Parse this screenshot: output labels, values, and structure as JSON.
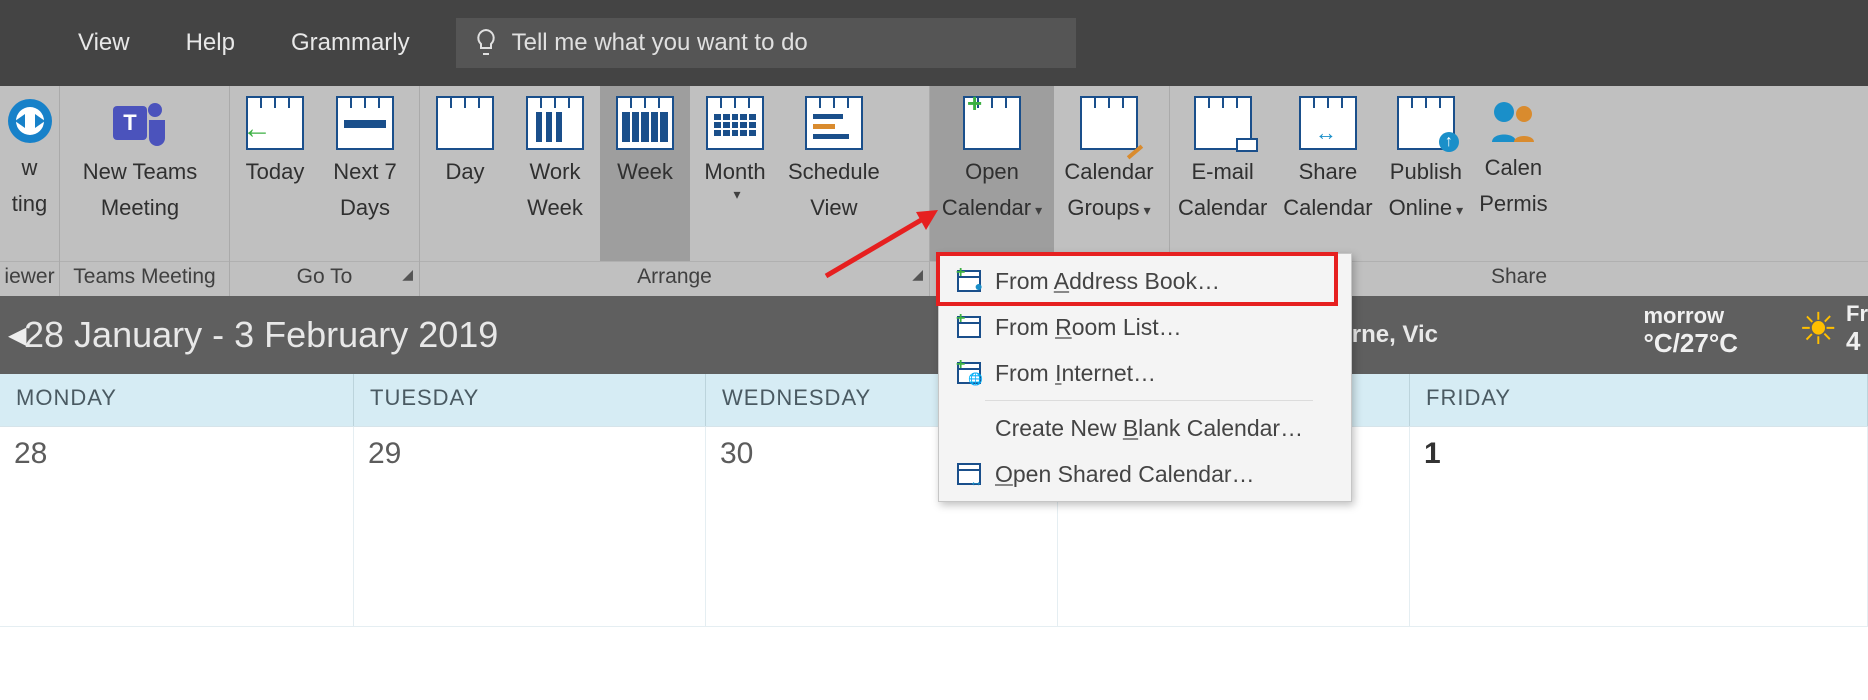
{
  "menu": {
    "view": "View",
    "help": "Help",
    "grammarly": "Grammarly",
    "tellme_placeholder": "Tell me what you want to do"
  },
  "ribbon": {
    "teamviewer": {
      "line1": "w",
      "line2": "ting",
      "group_label": "iewer"
    },
    "teams_meeting": {
      "label1": "New Teams",
      "label2": "Meeting",
      "group_label": "Teams Meeting"
    },
    "goto": {
      "today": "Today",
      "next7_1": "Next 7",
      "next7_2": "Days",
      "group_label": "Go To"
    },
    "arrange": {
      "day": "Day",
      "workweek_1": "Work",
      "workweek_2": "Week",
      "week": "Week",
      "month": "Month",
      "schedule_1": "Schedule",
      "schedule_2": "View",
      "group_label": "Arrange"
    },
    "manage": {
      "open_1": "Open",
      "open_2": "Calendar",
      "groups_1": "Calendar",
      "groups_2": "Groups"
    },
    "share": {
      "email_1": "E-mail",
      "email_2": "Calendar",
      "share_1": "Share",
      "share_2": "Calendar",
      "publish_1": "Publish",
      "publish_2": "Online",
      "perm_1": "Calen",
      "perm_2": "Permis",
      "group_label": "Share"
    }
  },
  "dropdown": {
    "address_book": "From Address Book…",
    "room_list": "From Room List…",
    "internet": "From Internet…",
    "blank": "Create New Blank Calendar…",
    "shared": "Open Shared Calendar…"
  },
  "date_strip": {
    "range": "28 January - 3 February 2019",
    "location": "Melbourne, Vic",
    "tomorrow_label": "morrow",
    "tomorrow_temp": "°C/27°C",
    "fri_label": "Fr",
    "fri_temp": "4"
  },
  "calendar": {
    "headers": [
      "MONDAY",
      "TUESDAY",
      "WEDNESDAY",
      "",
      "FRIDAY"
    ],
    "dates": [
      "28",
      "29",
      "30",
      "",
      "1"
    ]
  }
}
